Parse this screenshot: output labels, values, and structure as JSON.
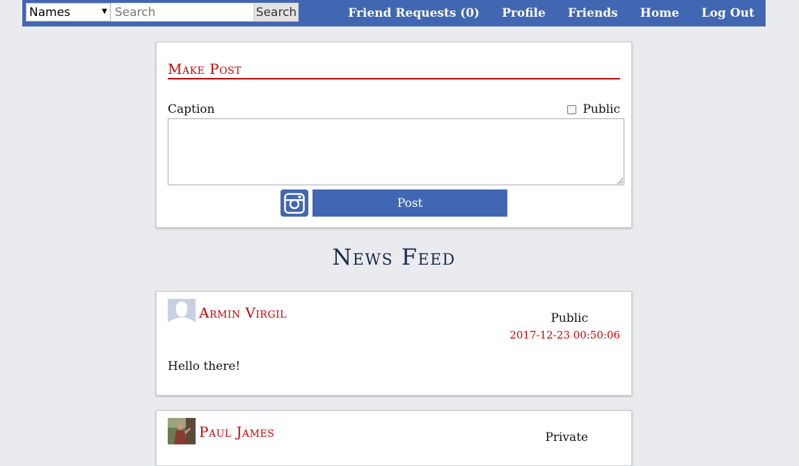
{
  "nav": {
    "search_type": "Names",
    "search_placeholder": "Search",
    "search_button": "Search",
    "links": [
      "Friend Requests (0)",
      "Profile",
      "Friends",
      "Home",
      "Log Out"
    ]
  },
  "make_post": {
    "title": "Make Post",
    "caption_label": "Caption",
    "public_label": "Public",
    "public_checked": false,
    "caption_value": "",
    "post_button": "Post"
  },
  "feed": {
    "title": "News Feed",
    "posts": [
      {
        "author": "Armin Virgil",
        "visibility": "Public",
        "timestamp": "2017-12-23 00:50:06",
        "body": "Hello there!"
      },
      {
        "author": "Paul James",
        "visibility": "Private"
      }
    ]
  },
  "colors": {
    "nav_blue": "#4267b2",
    "accent_red": "#cc0000",
    "background": "#e9ebee",
    "heading_navy": "#1c2a4a"
  }
}
